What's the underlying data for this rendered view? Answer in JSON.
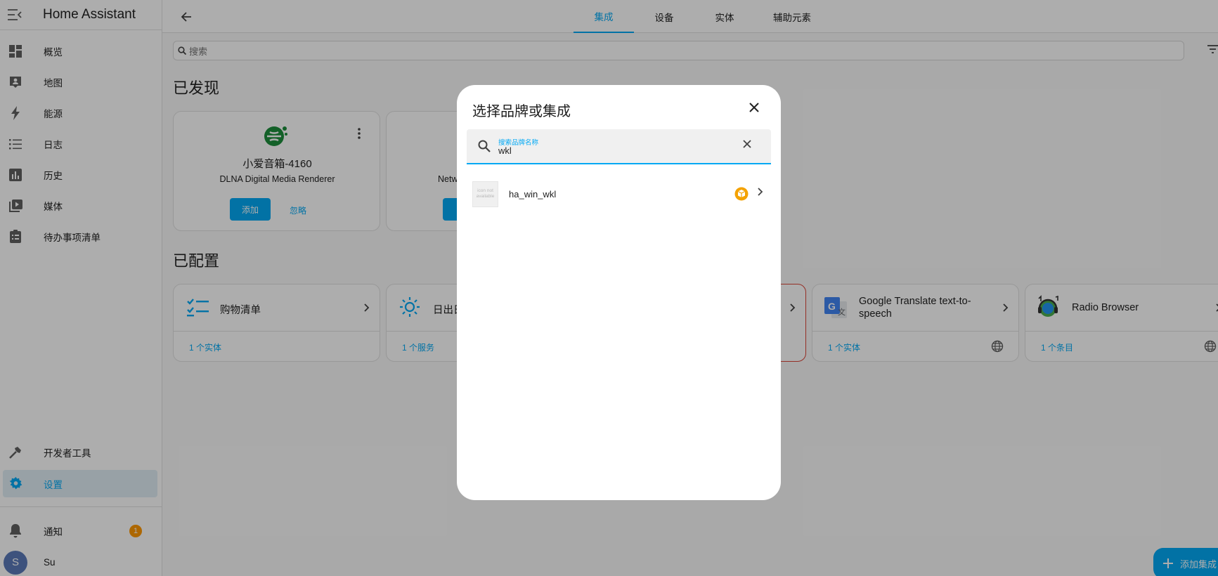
{
  "app": {
    "title": "Home Assistant"
  },
  "sidebar": {
    "items": [
      {
        "label": "概览",
        "icon": "dashboard-icon"
      },
      {
        "label": "地图",
        "icon": "map-account-icon"
      },
      {
        "label": "能源",
        "icon": "lightning-icon"
      },
      {
        "label": "日志",
        "icon": "logbook-list-icon"
      },
      {
        "label": "历史",
        "icon": "history-chart-icon"
      },
      {
        "label": "媒体",
        "icon": "media-play-icon"
      },
      {
        "label": "待办事项清单",
        "icon": "clipboard-list-icon"
      }
    ],
    "developer_tools": "开发者工具",
    "settings": "设置",
    "notifications": "通知",
    "notification_count": "1",
    "user_initial": "S",
    "user_name": "Su"
  },
  "topbar": {
    "tabs": [
      "集成",
      "设备",
      "实体",
      "辅助元素"
    ],
    "active_tab": "集成"
  },
  "search": {
    "placeholder": "搜索"
  },
  "discovered": {
    "title": "已发现",
    "cards": [
      {
        "name": "小爱音箱-4160",
        "subtitle": "DLNA Digital Media Renderer",
        "add_label": "添加",
        "ignore_label": "忽略"
      },
      {
        "partial_text": "Netw"
      }
    ]
  },
  "configured": {
    "title": "已配置",
    "cards": [
      {
        "name": "购物清单",
        "footer": "1 个实体"
      },
      {
        "name": "日出日",
        "footer": "1 个服务"
      },
      {
        "name": "Google Translate text-to-speech",
        "footer": "1 个实体"
      },
      {
        "name": "Radio Browser",
        "footer": "1 个条目"
      }
    ]
  },
  "fab": {
    "label": "添加集成"
  },
  "dialog": {
    "title": "选择品牌或集成",
    "search_label": "搜索品牌名称",
    "search_value": "wkl",
    "results": [
      {
        "name": "ha_win_wkl",
        "image_placeholder": "icon not available"
      }
    ]
  },
  "colors": {
    "accent": "#03a9f4",
    "badge": "#ff9800",
    "custom_integration": "#f4a200",
    "error_border": "#db4437"
  }
}
